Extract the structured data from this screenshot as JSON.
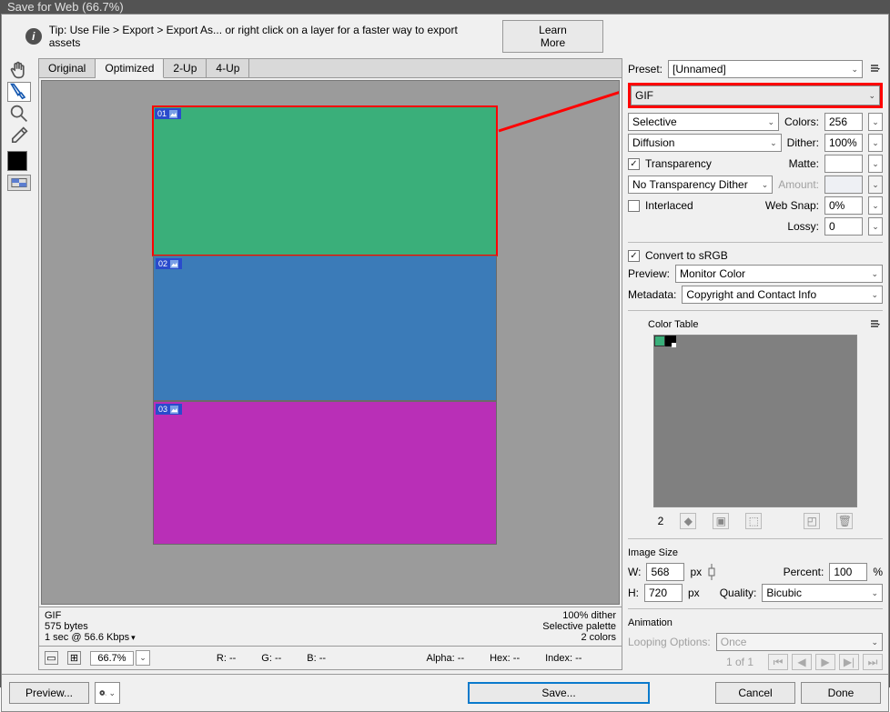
{
  "title": "Save for Web (66.7%)",
  "tip": "Tip: Use File > Export > Export As...  or right click on a layer for a faster way to export assets",
  "learnMore": "Learn More",
  "tabs": [
    "Original",
    "Optimized",
    "2-Up",
    "4-Up"
  ],
  "slices": [
    {
      "id": "01",
      "color": "#3aaf7a"
    },
    {
      "id": "02",
      "color": "#3b7bb8"
    },
    {
      "id": "03",
      "color": "#b92fb7"
    }
  ],
  "info": {
    "format": "GIF",
    "size": "575 bytes",
    "time": "1 sec @ 56.6 Kbps",
    "ditherPct": "100% dither",
    "palette": "Selective palette",
    "colors2": "2 colors"
  },
  "status": {
    "zoom": "66.7%",
    "R": "R: --",
    "G": "G: --",
    "B": "B: --",
    "Alpha": "Alpha: --",
    "Hex": "Hex: --",
    "Index": "Index: --"
  },
  "right": {
    "presetLabel": "Preset:",
    "preset": "[Unnamed]",
    "format": "GIF",
    "reduction": "Selective",
    "colorsLabel": "Colors:",
    "colors": "256",
    "dither": "Diffusion",
    "ditherLabel": "Dither:",
    "ditherPct": "100%",
    "transparency": "Transparency",
    "matteLabel": "Matte:",
    "matte": "",
    "transDither": "No Transparency Dither",
    "amountLabel": "Amount:",
    "amount": "",
    "interlaced": "Interlaced",
    "websnapLabel": "Web Snap:",
    "websnap": "0%",
    "lossyLabel": "Lossy:",
    "lossy": "0",
    "srgb": "Convert to sRGB",
    "previewLabel": "Preview:",
    "preview": "Monitor Color",
    "metaLabel": "Metadata:",
    "meta": "Copyright and Contact Info",
    "colorTable": "Color Table",
    "ctCount": "2",
    "imageSize": "Image Size",
    "w": "568",
    "h": "720",
    "px": "px",
    "percentLabel": "Percent:",
    "percent": "100",
    "pct": "%",
    "wLabel": "W:",
    "hLabel": "H:",
    "qualityLabel": "Quality:",
    "quality": "Bicubic",
    "animation": "Animation",
    "loopLabel": "Looping Options:",
    "loop": "Once",
    "pager": "1 of 1"
  },
  "footer": {
    "preview": "Preview...",
    "save": "Save...",
    "cancel": "Cancel",
    "done": "Done"
  }
}
